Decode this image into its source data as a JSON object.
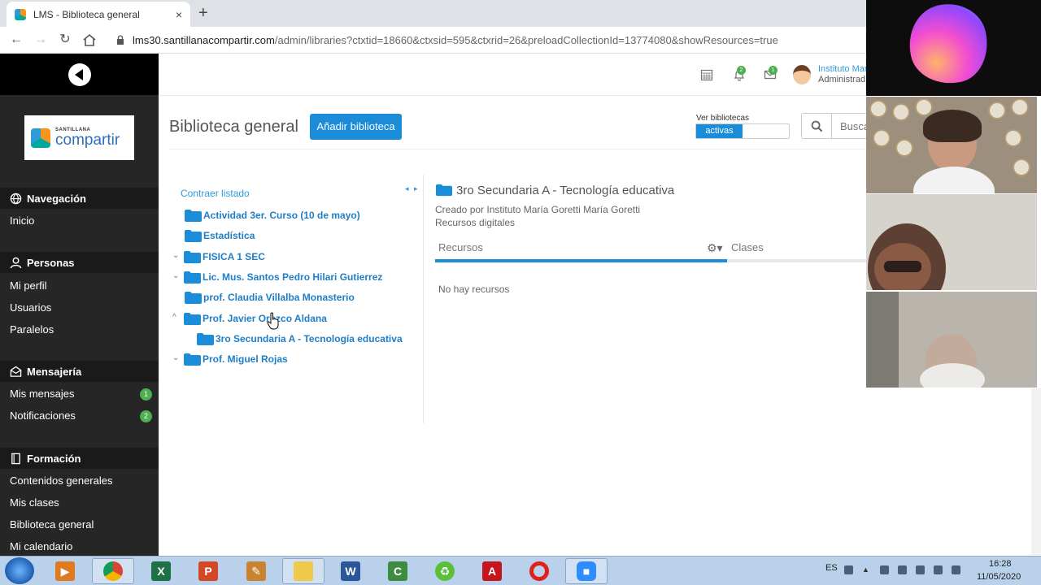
{
  "browser": {
    "tab_title": "LMS - Biblioteca general",
    "tab_close": "×",
    "new_tab": "+",
    "url_host": "lms30.santillanacompartir.com",
    "url_path": "/admin/libraries?ctxtid=18660&ctxsid=595&ctxrid=26&preloadCollectionId=13774080&showResources=true"
  },
  "sidebar": {
    "logo_small": "SANTILLANA",
    "logo_big": "compartir",
    "sections": [
      {
        "title": "Navegación",
        "icon": "globe-icon",
        "items": [
          {
            "label": "Inicio"
          }
        ]
      },
      {
        "title": "Personas",
        "icon": "person-icon",
        "items": [
          {
            "label": "Mi perfil"
          },
          {
            "label": "Usuarios"
          },
          {
            "label": "Paralelos"
          }
        ]
      },
      {
        "title": "Mensajería",
        "icon": "envelope-icon",
        "items": [
          {
            "label": "Mis mensajes",
            "badge": "1"
          },
          {
            "label": "Notificaciones",
            "badge": "2"
          }
        ]
      },
      {
        "title": "Formación",
        "icon": "book-icon",
        "items": [
          {
            "label": "Contenidos generales"
          },
          {
            "label": "Mis clases"
          },
          {
            "label": "Biblioteca general"
          },
          {
            "label": "Mi calendario"
          }
        ]
      }
    ]
  },
  "header": {
    "notif_badge": "2",
    "msg_badge": "1",
    "user_name": "Instituto Mar",
    "user_role": "Administrad"
  },
  "main": {
    "title": "Biblioteca general",
    "add_button": "Añadir biblioteca",
    "ver_label": "Ver bibliotecas",
    "toggle_on": "activas",
    "search_placeholder": "Busca",
    "collapse_link": "Contraer listado",
    "arrows": "◂ ▸",
    "tree": [
      {
        "label": "Actividad 3er. Curso (10 de mayo)",
        "caret": ""
      },
      {
        "label": "Estadística",
        "caret": ""
      },
      {
        "label": "FISICA 1 SEC",
        "caret": "⌄"
      },
      {
        "label": "Lic. Mus. Santos Pedro Hilari Gutierrez",
        "caret": "⌄"
      },
      {
        "label": "prof. Claudia Villalba Monasterio",
        "caret": ""
      },
      {
        "label": "Prof. Javier Orozco Aldana",
        "caret": "^"
      },
      {
        "label": "3ro Secundaria A - Tecnología educativa",
        "caret": ""
      },
      {
        "label": "Prof. Miguel Rojas",
        "caret": "⌄"
      }
    ],
    "selected_title": "3ro Secundaria A - Tecnología educativa",
    "created_by": "Creado por Instituto María Goretti María Goretti",
    "resource_type": "Recursos digitales",
    "tab_resources": "Recursos",
    "tab_classes": "Clases",
    "empty_text": "No hay recursos"
  },
  "taskbar": {
    "lang": "ES",
    "time": "16:28",
    "date": "11/05/2020"
  },
  "colors": {
    "accent": "#1a8cd8",
    "link": "#1f7ec6",
    "sidebar_bg": "#262626",
    "badge_green": "#4caf50"
  }
}
